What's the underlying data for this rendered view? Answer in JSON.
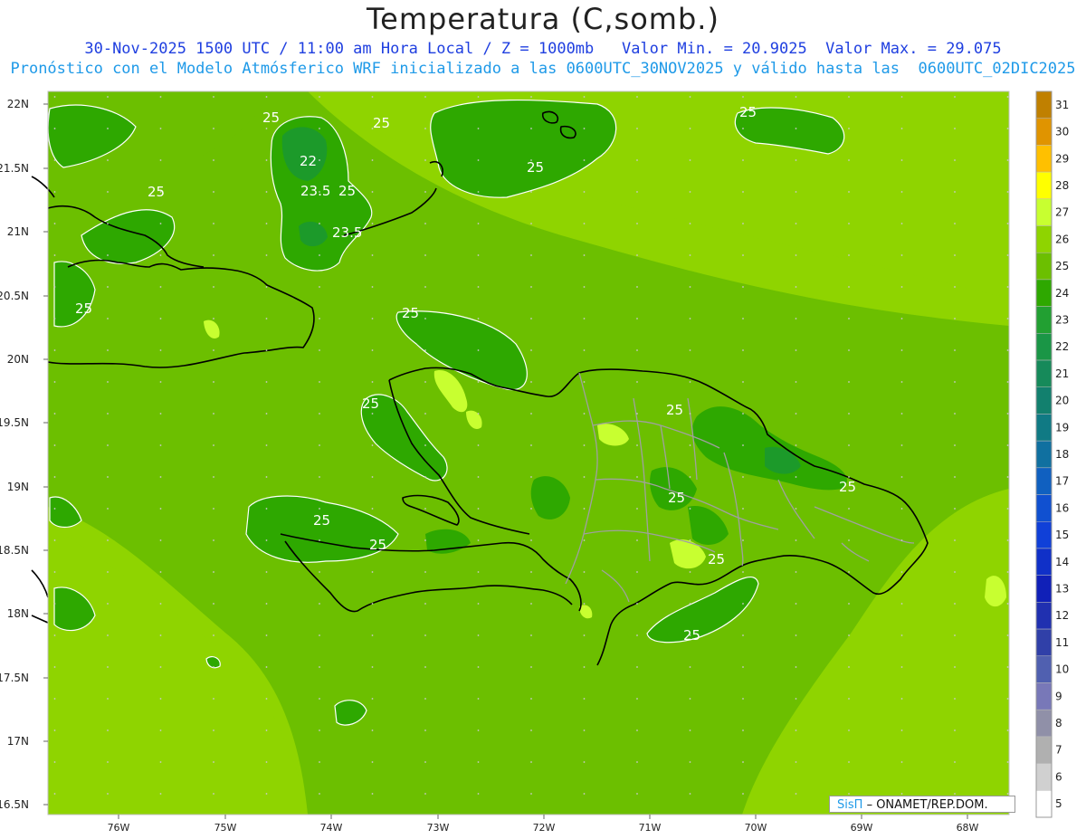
{
  "header": {
    "title": "Temperatura (C,somb.)",
    "line1": "30-Nov-2025 1500 UTC / 11:00 am Hora Local / Z = 1000mb   Valor Min. = 20.9025  Valor Max. = 29.075",
    "line2": "Pronóstico con el Modelo Atmósferico WRF inicializado a las 0600UTC_30NOV2025 y válido hasta las  0600UTC_02DIC2025"
  },
  "map": {
    "lat_labels": [
      "22N",
      "21.5N",
      "21N",
      "20.5N",
      "20N",
      "19.5N",
      "19N",
      "18.5N",
      "18N",
      "17.5N",
      "17N",
      "16.5N"
    ],
    "lon_labels": [
      "76W",
      "75W",
      "74W",
      "73W",
      "72W",
      "71W",
      "70W",
      "69W",
      "68W"
    ],
    "contour_labels": [
      "25",
      "25",
      "25",
      "25",
      "25",
      "25",
      "25",
      "25",
      "25",
      "25",
      "25",
      "25",
      "25",
      "25",
      "22",
      "23.5",
      "23.5",
      "25"
    ],
    "colors": {
      "land_border": "#000000",
      "province_border": "#a0a0a0",
      "contour_line": "#ffffff",
      "sea_light": "#8fd400",
      "mid": "#6cbf00",
      "dark": "#2ea800",
      "darker": "#1c9a2a"
    }
  },
  "colorbar": {
    "labels": [
      "31",
      "30",
      "29",
      "28",
      "27",
      "26",
      "25",
      "24",
      "23",
      "22",
      "21",
      "20",
      "19",
      "18",
      "17",
      "16",
      "15",
      "14",
      "13",
      "12",
      "11",
      "10",
      "9",
      "8",
      "7",
      "6",
      "5"
    ],
    "colors": [
      "#c08000",
      "#e09400",
      "#ffc000",
      "#ffff00",
      "#c8ff30",
      "#8fd400",
      "#6cbf00",
      "#2ea800",
      "#22a032",
      "#1a9646",
      "#168a5a",
      "#12806e",
      "#107a84",
      "#1070a0",
      "#1060c0",
      "#1050d0",
      "#1040d8",
      "#1030c8",
      "#1020b8",
      "#2030b0",
      "#3040a8",
      "#5060b0",
      "#7878b8",
      "#9090a8",
      "#b0b0b0",
      "#d0d0d0",
      "#ffffff"
    ]
  },
  "credit": {
    "sis": "SisΠ",
    "text": "– ONAMET/REP.DOM."
  }
}
